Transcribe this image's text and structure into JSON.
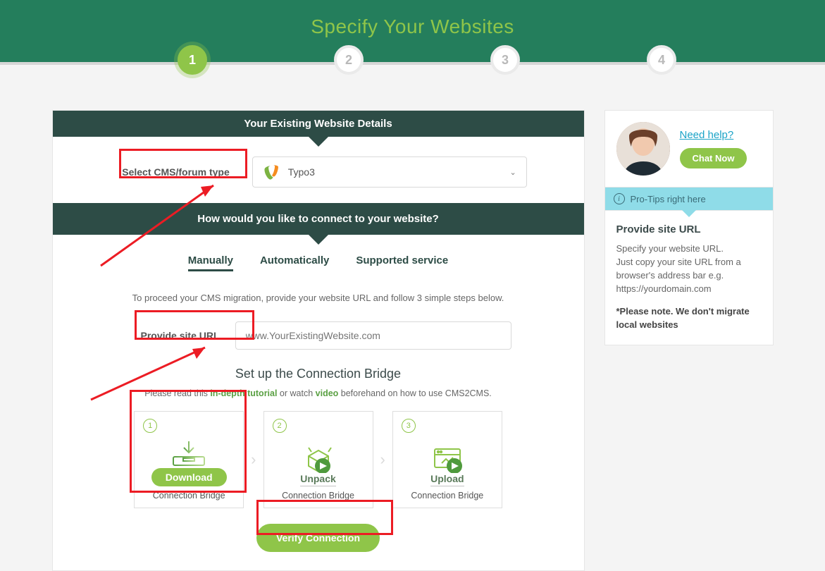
{
  "hero": {
    "title": "Specify Your Websites"
  },
  "steps": {
    "labels": [
      "1",
      "2",
      "3",
      "4"
    ],
    "active": 0
  },
  "panel1": {
    "title": "Your Existing Website Details",
    "label": "Select CMS/forum type",
    "selected": "Typo3"
  },
  "panel2": {
    "title": "How would you like to connect to your website?",
    "tabs": {
      "manually": "Manually",
      "auto": "Automatically",
      "supported": "Supported service"
    },
    "instruction": "To proceed your CMS migration, provide your website URL and follow 3 simple steps below.",
    "url_label": "Provide site URL",
    "url_placeholder": "www.YourExistingWebsite.com",
    "bridge_title": "Set up the Connection Bridge",
    "fineprint_pre": "Please read this ",
    "fineprint_link1": "in-depth tutorial",
    "fineprint_mid": " or watch ",
    "fineprint_link2": "video",
    "fineprint_post": " beforehand on how to use CMS2CMS.",
    "cards": [
      {
        "n": "1",
        "action": "Download",
        "sub": "Connection Bridge"
      },
      {
        "n": "2",
        "action": "Unpack",
        "sub": "Connection Bridge"
      },
      {
        "n": "3",
        "action": "Upload",
        "sub": "Connection Bridge"
      }
    ],
    "verify": "Verify Connection"
  },
  "sidebar": {
    "help_link": "Need help?",
    "chat": "Chat Now",
    "tips_label": "Pro-Tips right here",
    "tip_title": "Provide site URL",
    "tip_body": "Specify your website URL.\nJust copy your site URL from a browser's address bar e.g. https://yourdomain.com",
    "tip_note": "*Please note. We don't migrate local websites"
  }
}
